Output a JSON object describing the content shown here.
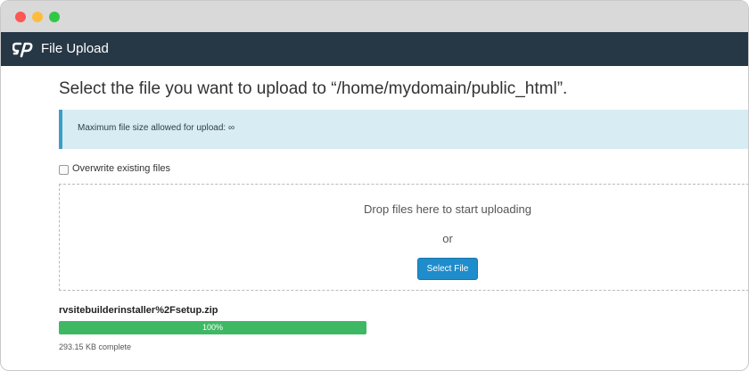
{
  "window": {
    "controls": [
      "close",
      "minimize",
      "maximize"
    ]
  },
  "app": {
    "title": "File Upload",
    "logo_icon": "cpanel-logo-icon"
  },
  "heading": "Select the file you want to upload to “/home/mydomain/public_html”.",
  "alert": {
    "text": "Maximum file size allowed for upload: ∞"
  },
  "overwrite": {
    "label": "Overwrite existing files",
    "checked": false
  },
  "dropzone": {
    "text": "Drop files here to start uploading",
    "or": "or",
    "button_label": "Select File"
  },
  "upload": {
    "file_name": "rvsitebuilderinstaller%2Fsetup.zip",
    "progress_percent": 100,
    "progress_label": "100%",
    "status": "293.15 KB complete"
  },
  "colors": {
    "appbar": "#263746",
    "accent": "#1f8ccb",
    "alert_bg": "#d8ecf3",
    "alert_border": "#3a9ec9",
    "progress": "#3fb863"
  }
}
